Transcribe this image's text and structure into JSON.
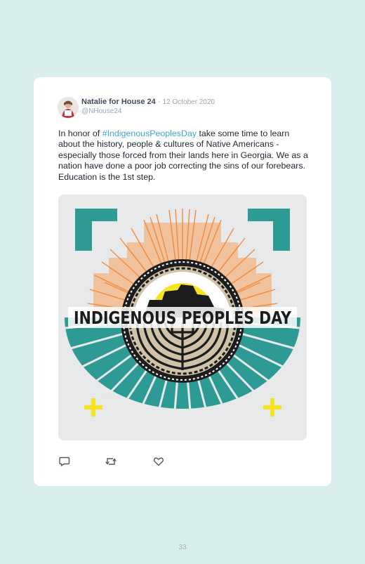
{
  "tweet": {
    "author_name": "Natalie for House 24",
    "separator": " · ",
    "date": "12 October 2020",
    "handle": "@NHouse24",
    "text_before": "In honor of ",
    "hashtag": "#IndigenousPeoplesDay",
    "text_after": " take some time to learn about the history, people & cultures of Native Americans - especially those forced from their lands here in Georgia. We as a nation have done a poor job correcting the sins of our forebears. Education is the 1st step."
  },
  "media": {
    "banner_text": "INDIGENOUS PEOPLES DAY",
    "colors": {
      "teal": "#2d9b93",
      "orange": "#f28a3c",
      "yellow": "#f6e51e",
      "tan": "#cfc2a9",
      "dark": "#1c1c1c"
    }
  },
  "actions": [
    {
      "name": "reply",
      "icon": "speech-bubble-icon"
    },
    {
      "name": "retweet",
      "icon": "retweet-arrows-icon"
    },
    {
      "name": "like",
      "icon": "heart-icon"
    }
  ],
  "page": {
    "number": "33"
  }
}
